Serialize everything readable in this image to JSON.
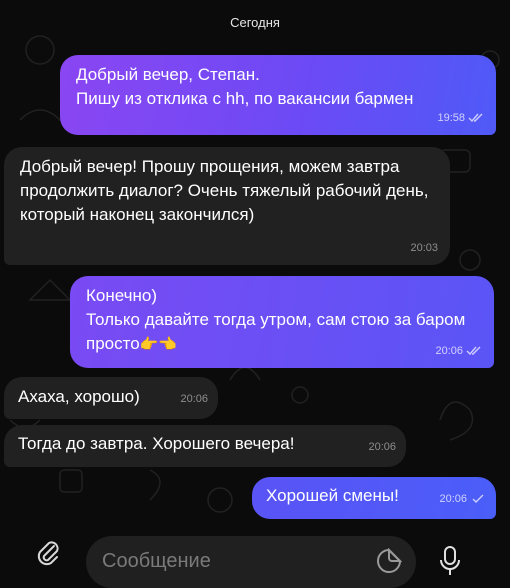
{
  "chat": {
    "date_label": "Сегодня",
    "messages": [
      {
        "direction": "out",
        "text": "Добрый вечер, Степан.\nПишу из отклика с hh, по вакансии бармен",
        "time": "19:58",
        "read": true
      },
      {
        "direction": "in",
        "text": "Добрый вечер! Прошу прощения, можем завтра продолжить диалог? Очень тяжелый рабочий день, который наконец закончился)",
        "time": "20:03"
      },
      {
        "direction": "out",
        "text": "Конечно)\nТолько давайте тогда утром, сам стою за баром просто",
        "emoji": "👉👈",
        "time": "20:06",
        "read": true
      },
      {
        "direction": "in",
        "text": "Ахаха, хорошо)",
        "time": "20:06"
      },
      {
        "direction": "in",
        "text": "Тогда до завтра. Хорошего вечера!",
        "time": "20:06"
      },
      {
        "direction": "out",
        "text": "Хорошей смены!",
        "time": "20:06",
        "read": false
      }
    ]
  },
  "composer": {
    "placeholder": "Сообщение",
    "attach_icon": "paperclip-icon",
    "sticker_icon": "sticker-icon",
    "mic_icon": "microphone-icon"
  },
  "colors": {
    "background": "#0b0b0b",
    "outgoing_gradient_start": "#8a46f2",
    "outgoing_gradient_end": "#4f5af7",
    "incoming": "#212121",
    "composer": "#202020"
  }
}
